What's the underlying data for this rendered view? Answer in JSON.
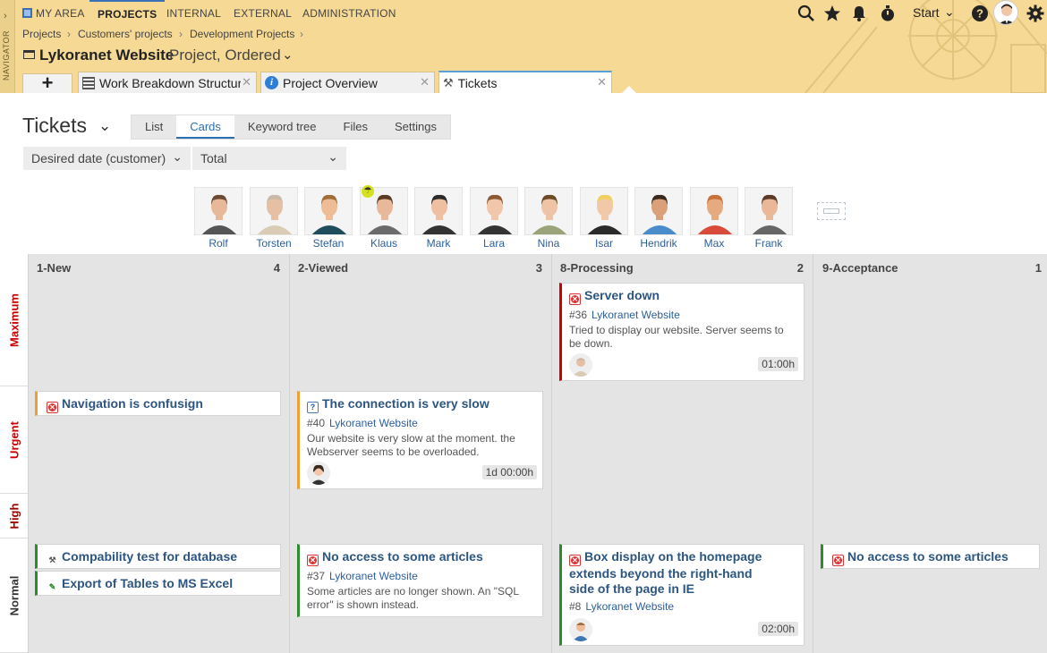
{
  "navigator": {
    "label": "NAVIGATOR"
  },
  "menu": {
    "items": [
      "MY AREA",
      "PROJECTS",
      "INTERNAL",
      "EXTERNAL",
      "ADMINISTRATION"
    ]
  },
  "toolbar": {
    "start_label": "Start"
  },
  "breadcrumb": [
    "Projects",
    "Customers' projects",
    "Development Projects"
  ],
  "project": {
    "name": "Lykoranet Website",
    "status": "Project, Ordered"
  },
  "tabs": [
    {
      "label": "Work Breakdown Structure"
    },
    {
      "label": "Project Overview"
    },
    {
      "label": "Tickets"
    }
  ],
  "page": {
    "title": "Tickets"
  },
  "views": [
    "List",
    "Cards",
    "Keyword tree",
    "Files",
    "Settings"
  ],
  "filters": {
    "sort": "Desired date (customer)",
    "scope": "Total"
  },
  "people": [
    {
      "name": "Rolf",
      "skin": "#e8b89a",
      "hair": "#6b4a33",
      "shirt": "#555"
    },
    {
      "name": "Torsten",
      "skin": "#e6c0a5",
      "hair": "#c8b9a8",
      "shirt": "#d9cbb4"
    },
    {
      "name": "Stefan",
      "skin": "#eebc96",
      "hair": "#a0703c",
      "shirt": "#1f4d5c"
    },
    {
      "name": "Klaus",
      "skin": "#e8b89a",
      "hair": "#5b3a26",
      "shirt": "#6a6a6a"
    },
    {
      "name": "Mark",
      "skin": "#eebfa0",
      "hair": "#2a2a2a",
      "shirt": "#333"
    },
    {
      "name": "Lara",
      "skin": "#f1c6aa",
      "hair": "#8b5a34",
      "shirt": "#333"
    },
    {
      "name": "Nina",
      "skin": "#efc3a6",
      "hair": "#6b4a25",
      "shirt": "#9aa37a"
    },
    {
      "name": "Isar",
      "skin": "#f2c9a8",
      "hair": "#f0d060",
      "shirt": "#2a2a2a"
    },
    {
      "name": "Hendrik",
      "skin": "#d9a07a",
      "hair": "#3a2a1e",
      "shirt": "#4a8cc9"
    },
    {
      "name": "Max",
      "skin": "#e6aa80",
      "hair": "#c8713a",
      "shirt": "#d84a3a"
    },
    {
      "name": "Frank",
      "skin": "#e8b898",
      "hair": "#5a3b28",
      "shirt": "#666"
    }
  ],
  "priorities": [
    "Maximum",
    "Urgent",
    "High",
    "Normal"
  ],
  "columns": [
    {
      "name": "1-New",
      "count": "4"
    },
    {
      "name": "2-Viewed",
      "count": "3"
    },
    {
      "name": "8-Processing",
      "count": "2"
    },
    {
      "name": "9-Acceptance",
      "count": "1"
    }
  ],
  "cards": {
    "server_down": {
      "title": "Server down",
      "id": "#36",
      "project": "Lykoranet Website",
      "desc": "Tried to display our website. Server seems to be down.",
      "time": "01:00h"
    },
    "nav_confusing": {
      "title": "Navigation is confusign"
    },
    "connection_slow": {
      "title": "The connection is very slow",
      "id": "#40",
      "project": "Lykoranet Website",
      "desc": "Our website is very slow at the moment. the Webserver seems to be overloaded.",
      "time": "1d 00:00h"
    },
    "compat_test": {
      "title": "Compability test for database"
    },
    "export_tables": {
      "title": "Export of Tables to MS Excel"
    },
    "no_access": {
      "title": "No access to some articles",
      "id": "#37",
      "project": "Lykoranet Website",
      "desc": "Some articles are no longer shown. An \"SQL error\" is shown instead."
    },
    "box_display": {
      "title": "Box display on the homepage extends beyond the right-hand side of the page in IE",
      "id": "#8",
      "project": "Lykoranet Website",
      "time": "02:00h"
    },
    "no_access2": {
      "title": "No access to some articles"
    }
  },
  "colors": {
    "header_bg": "#f6d995",
    "accent": "#2c6fb3",
    "red": "#cc0000",
    "orange": "#f0a030",
    "green": "#2e8b2e"
  }
}
